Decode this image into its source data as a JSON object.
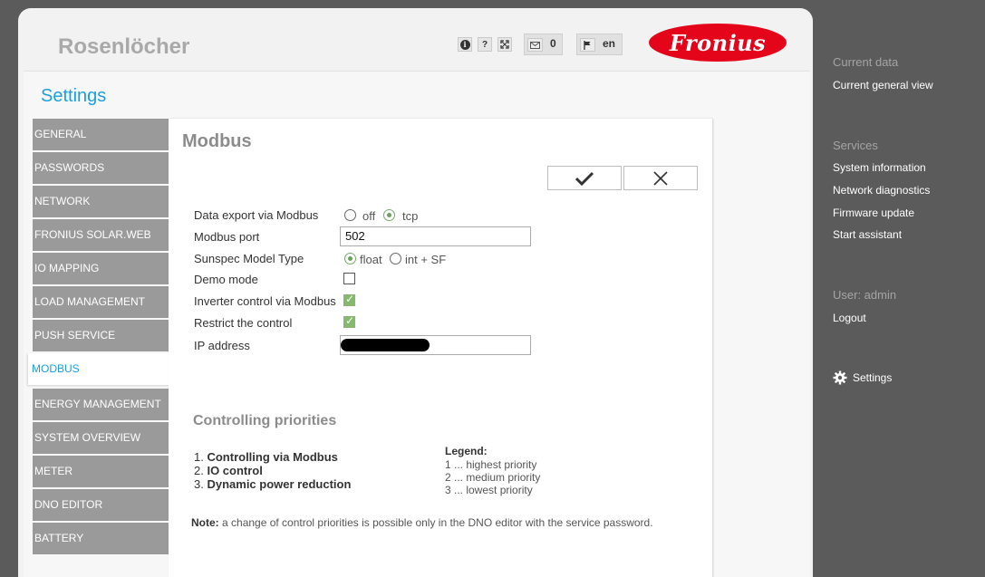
{
  "header": {
    "device_name": "Rosenlöcher",
    "info_icon": "i",
    "help_icon": "?",
    "messages_count": "0",
    "language": "en",
    "logo_text": "Fronius"
  },
  "settings_title": "Settings",
  "menu": [
    {
      "label": "GENERAL"
    },
    {
      "label": "PASSWORDS"
    },
    {
      "label": "NETWORK"
    },
    {
      "label": "FRONIUS SOLAR.WEB"
    },
    {
      "label": "IO MAPPING"
    },
    {
      "label": "LOAD MANAGEMENT"
    },
    {
      "label": "PUSH SERVICE"
    },
    {
      "label": "MODBUS",
      "active": true
    },
    {
      "label": "ENERGY MANAGEMENT"
    },
    {
      "label": "SYSTEM OVERVIEW"
    },
    {
      "label": "METER"
    },
    {
      "label": "DNO EDITOR"
    },
    {
      "label": "BATTERY"
    }
  ],
  "content": {
    "title": "Modbus",
    "fields": {
      "data_export": {
        "label": "Data export via Modbus",
        "options": [
          "off",
          "tcp"
        ],
        "selected": "tcp"
      },
      "port": {
        "label": "Modbus port",
        "value": "502"
      },
      "sunspec": {
        "label": "Sunspec Model Type",
        "options": [
          "float",
          "int + SF"
        ],
        "selected": "float"
      },
      "demo_mode": {
        "label": "Demo mode",
        "checked": false
      },
      "inverter_control": {
        "label": "Inverter control via Modbus",
        "checked": true
      },
      "restrict_control": {
        "label": "Restrict the control",
        "checked": true
      },
      "ip_address": {
        "label": "IP address",
        "value": ""
      }
    },
    "priorities": {
      "title": "Controlling priorities",
      "items": [
        {
          "num": "1.",
          "label": "Controlling via Modbus"
        },
        {
          "num": "2.",
          "label": "IO control"
        },
        {
          "num": "3.",
          "label": "Dynamic power reduction"
        }
      ],
      "legend_title": "Legend:",
      "legend": [
        "1 ... highest priority",
        "2 ... medium priority",
        "3 ... lowest priority"
      ]
    },
    "note_label": "Note:",
    "note_text": " a change of control priorities is possible only in the DNO editor with the service password."
  },
  "sidebar": {
    "current_data_head": "Current data",
    "current_general_view": "Current general view",
    "services_head": "Services",
    "services": [
      "System information",
      "Network diagnostics",
      "Firmware update",
      "Start assistant"
    ],
    "user_head": "User: admin",
    "logout": "Logout",
    "settings": "Settings"
  },
  "colors": {
    "accent": "#1aa0db",
    "menu_bg": "#9a9a9a",
    "sidebar_bg": "#5b5b5b",
    "logo_red": "#e4051a",
    "check_green": "#86b86f"
  }
}
